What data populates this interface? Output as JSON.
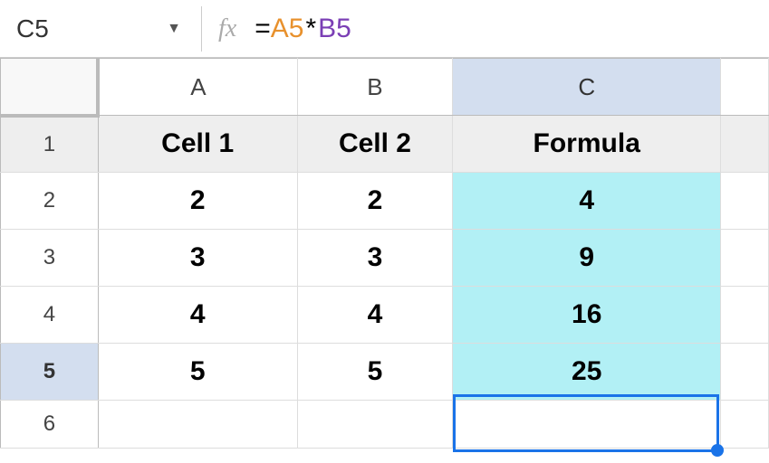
{
  "name_box": {
    "value": "C5"
  },
  "fx_label": "fx",
  "formula": {
    "eq": "=",
    "ref_a": "A5",
    "op": "*",
    "ref_b": "B5"
  },
  "columns": {
    "a": "A",
    "b": "B",
    "c": "C",
    "d": ""
  },
  "rows": {
    "r1": "1",
    "r2": "2",
    "r3": "3",
    "r4": "4",
    "r5": "5",
    "r6": "6"
  },
  "headers": {
    "cell1": "Cell 1",
    "cell2": "Cell 2",
    "formula": "Formula"
  },
  "grid": {
    "r2": {
      "a": "2",
      "b": "2",
      "c": "4"
    },
    "r3": {
      "a": "3",
      "b": "3",
      "c": "9"
    },
    "r4": {
      "a": "4",
      "b": "4",
      "c": "16"
    },
    "r5": {
      "a": "5",
      "b": "5",
      "c": "25"
    },
    "r6": {
      "a": "",
      "b": "",
      "c": ""
    }
  },
  "chart_data": {
    "type": "table",
    "title": "",
    "columns": [
      "Cell 1",
      "Cell 2",
      "Formula"
    ],
    "rows": [
      [
        2,
        2,
        4
      ],
      [
        3,
        3,
        9
      ],
      [
        4,
        4,
        16
      ],
      [
        5,
        5,
        25
      ]
    ],
    "selected_cell": "C5",
    "selected_formula": "=A5*B5"
  }
}
